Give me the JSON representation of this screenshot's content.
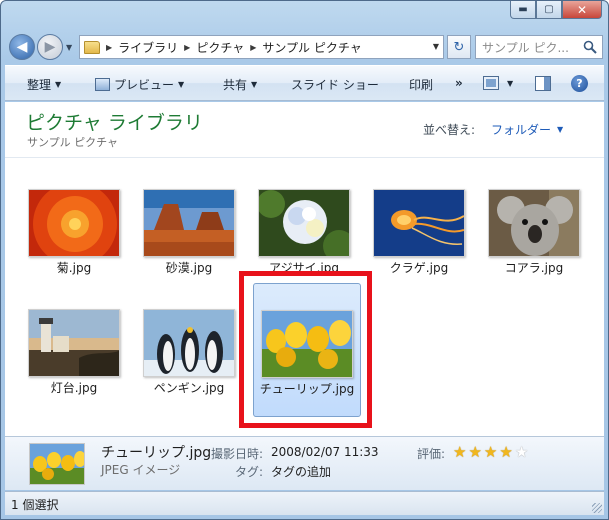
{
  "window": {
    "minimize_glyph": "▬",
    "maximize_glyph": "▢",
    "close_glyph": "✕"
  },
  "nav": {
    "back_glyph": "◀",
    "forward_glyph": "▶",
    "breadcrumb": [
      "ライブラリ",
      "ピクチャ",
      "サンプル ピクチャ"
    ],
    "search_placeholder": "サンプル ピク...",
    "refresh_glyph": "↻"
  },
  "commands": {
    "organize": "整理",
    "preview": "プレビュー",
    "share": "共有",
    "slideshow": "スライド ショー",
    "print": "印刷",
    "more": "»",
    "help": "?"
  },
  "library": {
    "title": "ピクチャ ライブラリ",
    "subtitle": "サンプル ピクチャ",
    "arrange_label": "並べ替え:",
    "arrange_value": "フォルダー"
  },
  "files": [
    {
      "label": "菊.jpg",
      "thumb": "chrysanthemum"
    },
    {
      "label": "砂漠.jpg",
      "thumb": "desert"
    },
    {
      "label": "アジサイ.jpg",
      "thumb": "hydrangeas"
    },
    {
      "label": "クラゲ.jpg",
      "thumb": "jellyfish"
    },
    {
      "label": "コアラ.jpg",
      "thumb": "koala"
    },
    {
      "label": "灯台.jpg",
      "thumb": "lighthouse"
    },
    {
      "label": "ペンギン.jpg",
      "thumb": "penguins"
    },
    {
      "label": "チューリップ.jpg",
      "thumb": "tulips",
      "selected": true
    }
  ],
  "details": {
    "name": "チューリップ.jpg",
    "type": "JPEG イメージ",
    "date_label": "撮影日時:",
    "date_value": "2008/02/07 11:33",
    "tags_label": "タグ:",
    "tags_value": "タグの追加",
    "rating_label": "評価:",
    "rating": 4,
    "rating_max": 5
  },
  "status": {
    "text": "1 個選択"
  },
  "colors": {
    "library_title": "#1e7b34",
    "link": "#1e5bb8",
    "highlight_box": "#e8121b",
    "selection": "#c1dbfc"
  }
}
